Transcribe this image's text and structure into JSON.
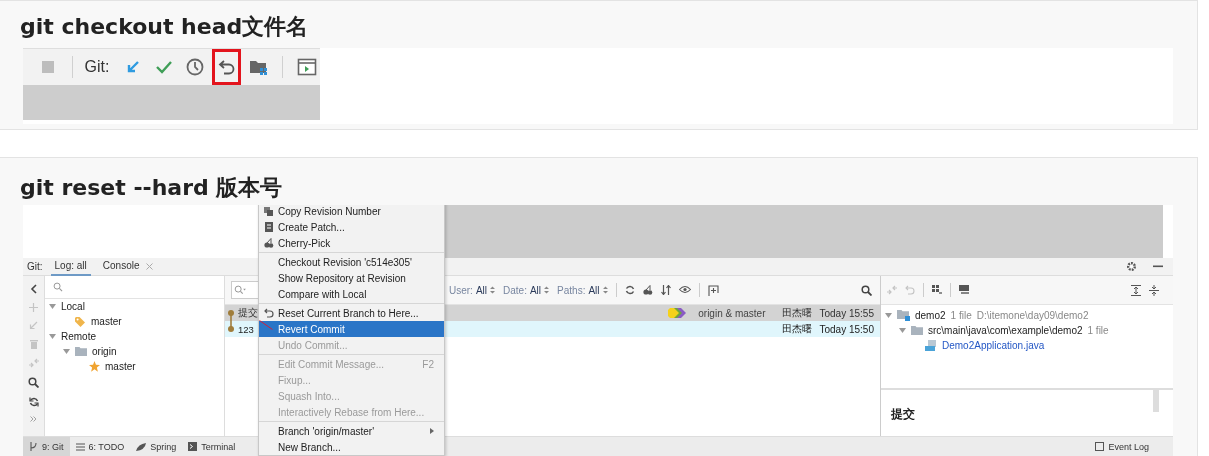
{
  "sections": [
    {
      "heading": "git checkout head文件名"
    },
    {
      "heading": "git reset --hard 版本号"
    }
  ],
  "toolbar": {
    "label": "Git:",
    "buttons": [
      {
        "highlighted": false
      },
      {
        "highlighted": false
      },
      {
        "highlighted": false
      },
      {
        "highlighted": false
      },
      {
        "highlighted": true
      },
      {
        "highlighted": false
      },
      {
        "highlighted": false
      }
    ]
  },
  "ide": {
    "tool_label": "Git:",
    "tabs": [
      {
        "label": "Log: all",
        "selected": true,
        "closable": false
      },
      {
        "label": "Console",
        "selected": false,
        "closable": true
      }
    ],
    "branches": [
      {
        "label": "Local",
        "expanded": true,
        "children": [
          {
            "label": "master",
            "kind": "local"
          }
        ]
      },
      {
        "label": "Remote",
        "expanded": true,
        "children": [
          {
            "label": "origin",
            "kind": "folder",
            "expanded": true,
            "children": [
              {
                "label": "master",
                "kind": "favorite"
              }
            ]
          }
        ]
      }
    ],
    "filters": [
      {
        "label": "User:",
        "value": "All"
      },
      {
        "label": "Date:",
        "value": "All"
      },
      {
        "label": "Paths:",
        "value": "All"
      }
    ],
    "commits": [
      {
        "message": "提交",
        "refs": "origin & master",
        "author": "田杰曙",
        "date": "Today 15:55",
        "selected": true,
        "current": false
      },
      {
        "message": "123",
        "author": "田杰曙",
        "date": "Today 15:50",
        "selected": false,
        "current": true
      }
    ],
    "changes": [
      {
        "label": "demo2",
        "kind": "module",
        "count": "1 file",
        "path": "D:\\itemone\\day09\\demo2",
        "expanded": true,
        "children": [
          {
            "label": "src\\main\\java\\com\\example\\demo2",
            "kind": "folder",
            "count": "1 file",
            "expanded": true,
            "children": [
              {
                "label": "Demo2Application.java",
                "kind": "file"
              }
            ]
          }
        ]
      }
    ],
    "details_title": "提交",
    "menu": [
      [
        {
          "label": "Copy Revision Number",
          "disabled": false,
          "selected": false,
          "submenu": false
        },
        {
          "label": "Create Patch...",
          "disabled": false,
          "selected": false,
          "submenu": false
        },
        {
          "label": "Cherry-Pick",
          "disabled": false,
          "selected": false,
          "submenu": false
        }
      ],
      [
        {
          "label": "Checkout Revision 'c514e305'",
          "disabled": false,
          "selected": false,
          "submenu": false
        },
        {
          "label": "Show Repository at Revision",
          "disabled": false,
          "selected": false,
          "submenu": false
        },
        {
          "label": "Compare with Local",
          "disabled": false,
          "selected": false,
          "submenu": false
        }
      ],
      [
        {
          "label": "Reset Current Branch to Here...",
          "disabled": false,
          "selected": false,
          "submenu": false
        },
        {
          "label": "Revert Commit",
          "disabled": false,
          "selected": true,
          "submenu": false
        },
        {
          "label": "Undo Commit...",
          "disabled": true,
          "selected": false,
          "submenu": false
        }
      ],
      [
        {
          "label": "Edit Commit Message...",
          "shortcut": "F2",
          "disabled": true,
          "selected": false,
          "submenu": false
        },
        {
          "label": "Fixup...",
          "disabled": true,
          "selected": false,
          "submenu": false
        },
        {
          "label": "Squash Into...",
          "disabled": true,
          "selected": false,
          "submenu": false
        },
        {
          "label": "Interactively Rebase from Here...",
          "disabled": true,
          "selected": false,
          "submenu": false
        }
      ],
      [
        {
          "label": "Branch 'origin/master'",
          "submenu": true,
          "disabled": false,
          "selected": false
        },
        {
          "label": "New Branch...",
          "disabled": false,
          "selected": false,
          "submenu": false
        }
      ]
    ],
    "bottom_tabs": [
      {
        "label": "9: Git",
        "selected": true
      },
      {
        "label": "6: TODO",
        "selected": false
      },
      {
        "label": "Spring",
        "selected": false
      },
      {
        "label": "Terminal",
        "selected": false
      }
    ],
    "event_log": "Event Log"
  }
}
